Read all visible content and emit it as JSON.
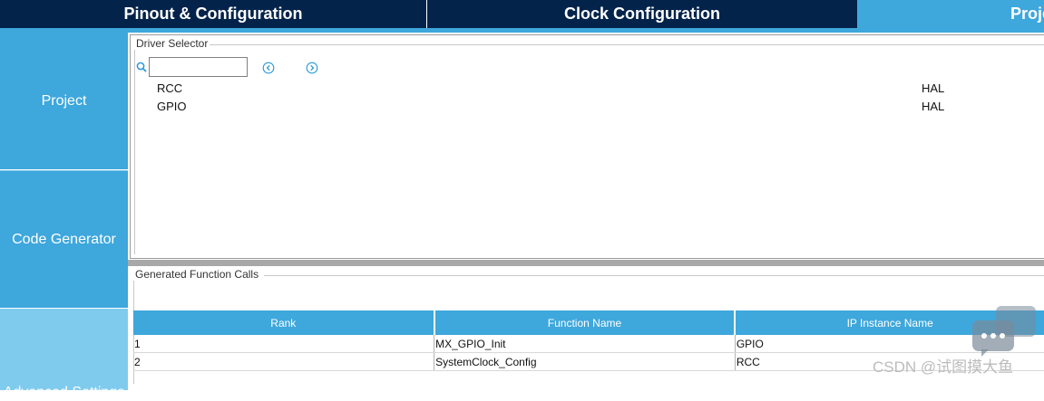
{
  "tabs": [
    {
      "label": "Pinout & Configuration"
    },
    {
      "label": "Clock Configuration"
    },
    {
      "label": "Proje"
    }
  ],
  "sidebar": {
    "items": [
      {
        "label": "Project"
      },
      {
        "label": "Code Generator"
      },
      {
        "label": "Advanced Settings"
      }
    ]
  },
  "driver_selector": {
    "title": "Driver Selector",
    "search": {
      "value": "",
      "placeholder": ""
    },
    "icons": [
      "search-icon",
      "prev-icon",
      "next-icon"
    ],
    "rows": [
      {
        "name": "RCC",
        "driver": "HAL"
      },
      {
        "name": "GPIO",
        "driver": "HAL"
      }
    ]
  },
  "generated_calls": {
    "title": "Generated Function Calls",
    "columns": [
      "Rank",
      "Function Name",
      "IP Instance Name"
    ],
    "rows": [
      {
        "rank": "1",
        "function": "MX_GPIO_Init",
        "instance": "GPIO"
      },
      {
        "rank": "2",
        "function": "SystemClock_Config",
        "instance": "RCC"
      }
    ]
  },
  "watermark": {
    "text": "CSDN @试图摸大鱼"
  },
  "colors": {
    "dark_tab": "#03234b",
    "accent": "#3ea7dc",
    "accent_light": "#7fcbee"
  }
}
